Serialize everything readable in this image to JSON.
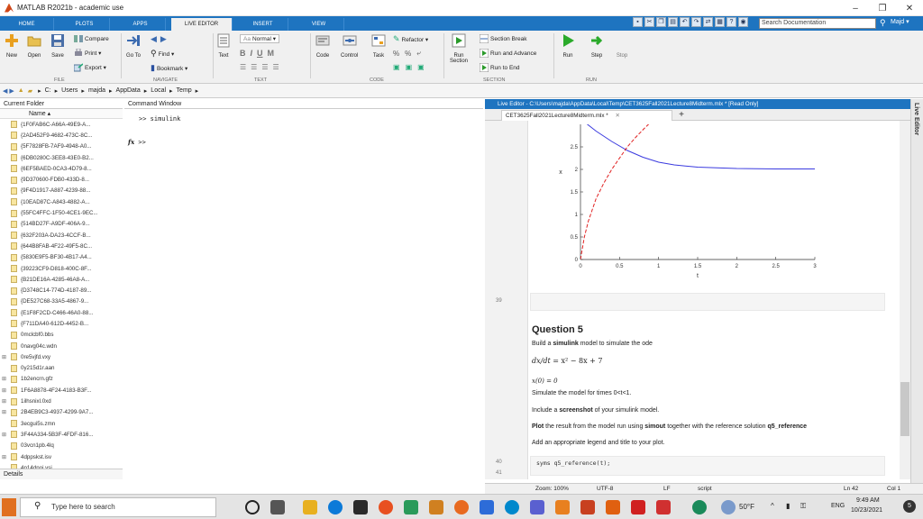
{
  "window": {
    "title": "MATLAB R2021b - academic use",
    "minimize": "–",
    "maximize": "❐",
    "close": "✕"
  },
  "ribbon_tabs": [
    "HOME",
    "PLOTS",
    "APPS",
    "LIVE EDITOR",
    "INSERT",
    "VIEW"
  ],
  "search_placeholder": "Search Documentation",
  "user": "Majd ▾",
  "ribbon": {
    "new": "New",
    "open": "Open",
    "save": "Save",
    "compare": "Compare",
    "print": "Print ▾",
    "export": "Export ▾",
    "goto": "Go To",
    "find": "Find ▾",
    "bookmark": "Bookmark ▾",
    "text": "Text",
    "normal": "Normal ▾",
    "code": "Code",
    "control": "Control",
    "task": "Task",
    "refactor": "Refactor ▾",
    "run_section": "Run Section",
    "section_break": "Section Break",
    "run_and_advance": "Run and Advance",
    "run_to_end": "Run to End",
    "run": "Run",
    "step": "Step",
    "stop": "Stop",
    "sections": {
      "file": "FILE",
      "navigate": "NAVIGATE",
      "text": "TEXT",
      "code": "CODE",
      "section": "SECTION",
      "run": "RUN"
    }
  },
  "address": [
    "C:",
    "Users",
    "majda",
    "AppData",
    "Local",
    "Temp"
  ],
  "current_folder": {
    "title": "Current Folder",
    "column": "Name ▴",
    "files": [
      {
        "exp": "",
        "name": "{1F0FAB6C-A66A-49E9-A..."
      },
      {
        "exp": "",
        "name": "{2AD452F9-4682-473C-8C..."
      },
      {
        "exp": "",
        "name": "{5F7828FB-7AF9-4948-A0..."
      },
      {
        "exp": "",
        "name": "{6DB0280C-3EE8-43E0-B2..."
      },
      {
        "exp": "",
        "name": "{6EF5BAED-0CA3-4D79-8..."
      },
      {
        "exp": "",
        "name": "{9D370600-FDB0-433D-8..."
      },
      {
        "exp": "",
        "name": "{9F4D1917-A887-4239-88..."
      },
      {
        "exp": "",
        "name": "{10EAD87C-A843-4882-A..."
      },
      {
        "exp": "",
        "name": "{55FC4FFC-1F50-4CE1-9EC..."
      },
      {
        "exp": "",
        "name": "{514BD27F-A9DF-406A-9..."
      },
      {
        "exp": "",
        "name": "{632F203A-DA23-4CCF-B..."
      },
      {
        "exp": "",
        "name": "{644B8FAB-4F22-49F5-8C..."
      },
      {
        "exp": "",
        "name": "{5830E9F5-BF30-4B17-A4..."
      },
      {
        "exp": "",
        "name": "{39223CF9-D818-400C-8F..."
      },
      {
        "exp": "",
        "name": "{B21DE16A-4285-46A8-A..."
      },
      {
        "exp": "",
        "name": "{D3748C14-774D-4187-89..."
      },
      {
        "exp": "",
        "name": "{DE527C68-33A5-4867-9..."
      },
      {
        "exp": "",
        "name": "{E1F8F2CD-C466-46A0-88..."
      },
      {
        "exp": "",
        "name": "{F711DA40-612D-4452-B..."
      },
      {
        "exp": "",
        "name": "0mclcbf0.bbs"
      },
      {
        "exp": "",
        "name": "0navg04c.wdn"
      },
      {
        "exp": "⊞",
        "name": "0re5vjfd.vxy"
      },
      {
        "exp": "",
        "name": "0y215d1r.aan"
      },
      {
        "exp": "⊞",
        "name": "1b2encrn.gfz"
      },
      {
        "exp": "⊞",
        "name": "1F6A8878-4F24-4183-B3F..."
      },
      {
        "exp": "⊞",
        "name": "1ilhsnixl.0xd"
      },
      {
        "exp": "⊞",
        "name": "2B4EB9C3-4937-4299-9A7..."
      },
      {
        "exp": "",
        "name": "3ecgui5s.zmn"
      },
      {
        "exp": "⊞",
        "name": "3F44A334-5B3F-4FDF-816..."
      },
      {
        "exp": "",
        "name": "03vcn1pb.4lq"
      },
      {
        "exp": "⊞",
        "name": "4dppskst.isv"
      },
      {
        "exp": "",
        "name": "4p14dnoj.vsi"
      }
    ],
    "details": "Details"
  },
  "command_window": {
    "title": "Command Window",
    "line1": ">> simulink",
    "prompt_fx": "fx",
    "prompt": ">>"
  },
  "live_editor": {
    "header": "Live Editor - C:\\Users\\majda\\AppData\\Local\\Temp\\CET3625Fall2021Lecture8Midterm.mlx * [Read Only]",
    "tab": "CET3625Fall2021Lecture8Midterm.mlx *",
    "tab_close": "✕",
    "add_tab": "+",
    "line_numbers": [
      "39",
      "40",
      "41"
    ],
    "question_title": "Question 5",
    "q_line1_pre": "Build a ",
    "q_line1_bold": "simulink",
    "q_line1_post": " model to simulate the ode",
    "ode_lhs": "dx/dt",
    "ode_rhs": "= x² − 8x + 7",
    "ic": "x(0) = 0",
    "q_sim": "Simulate the model for times 0<t<1.",
    "q_include_pre": "Include a ",
    "q_include_bold": "screenshot",
    "q_include_post": " of your simulink model.",
    "q_plot_pre": "Plot",
    "q_plot_mid": " the result from the model run using ",
    "q_plot_bold1": "simout",
    "q_plot_mid2": " together with the reference solution ",
    "q_plot_bold2": "q5_reference",
    "q_legend": "Add an appropriate legend and title to your plot.",
    "code40": "syms q5_reference(t);",
    "side_label": "Live Editor"
  },
  "chart_data": {
    "type": "line",
    "xlabel": "t",
    "ylabel": "x",
    "xlim": [
      0,
      3
    ],
    "ylim": [
      0,
      3
    ],
    "x_ticks": [
      "0",
      "0.5",
      "1",
      "1.5",
      "2",
      "2.5",
      "3"
    ],
    "y_ticks": [
      "0",
      "0.5",
      "1",
      "1.5",
      "2",
      "2.5"
    ],
    "series": [
      {
        "style": "solid",
        "color": "#3a3adf",
        "x": [
          0.0,
          0.2,
          0.4,
          0.6,
          0.8,
          1.0,
          1.2,
          1.5,
          2.0,
          2.5,
          3.0
        ],
        "y": [
          3.12,
          2.85,
          2.62,
          2.42,
          2.27,
          2.16,
          2.1,
          2.05,
          2.02,
          2.01,
          2.01
        ]
      },
      {
        "style": "dashed",
        "color": "#e02020",
        "x": [
          0.0,
          0.02,
          0.05,
          0.1,
          0.15,
          0.2,
          0.3,
          0.4,
          0.5,
          0.6,
          0.7,
          0.8,
          0.9
        ],
        "y": [
          0.0,
          0.2,
          0.5,
          0.85,
          1.1,
          1.35,
          1.7,
          2.0,
          2.25,
          2.5,
          2.7,
          2.88,
          3.05
        ]
      }
    ]
  },
  "status": {
    "zoom": "Zoom: 100%",
    "encoding": "UTF-8",
    "eol": "LF",
    "type": "script",
    "ln": "Ln 42",
    "col": "Col 1"
  },
  "taskbar": {
    "search": "Type here to search",
    "temp": "50°F",
    "lang": "ENG",
    "time": "9:49 AM",
    "date": "10/23/2021",
    "notif": "5"
  }
}
